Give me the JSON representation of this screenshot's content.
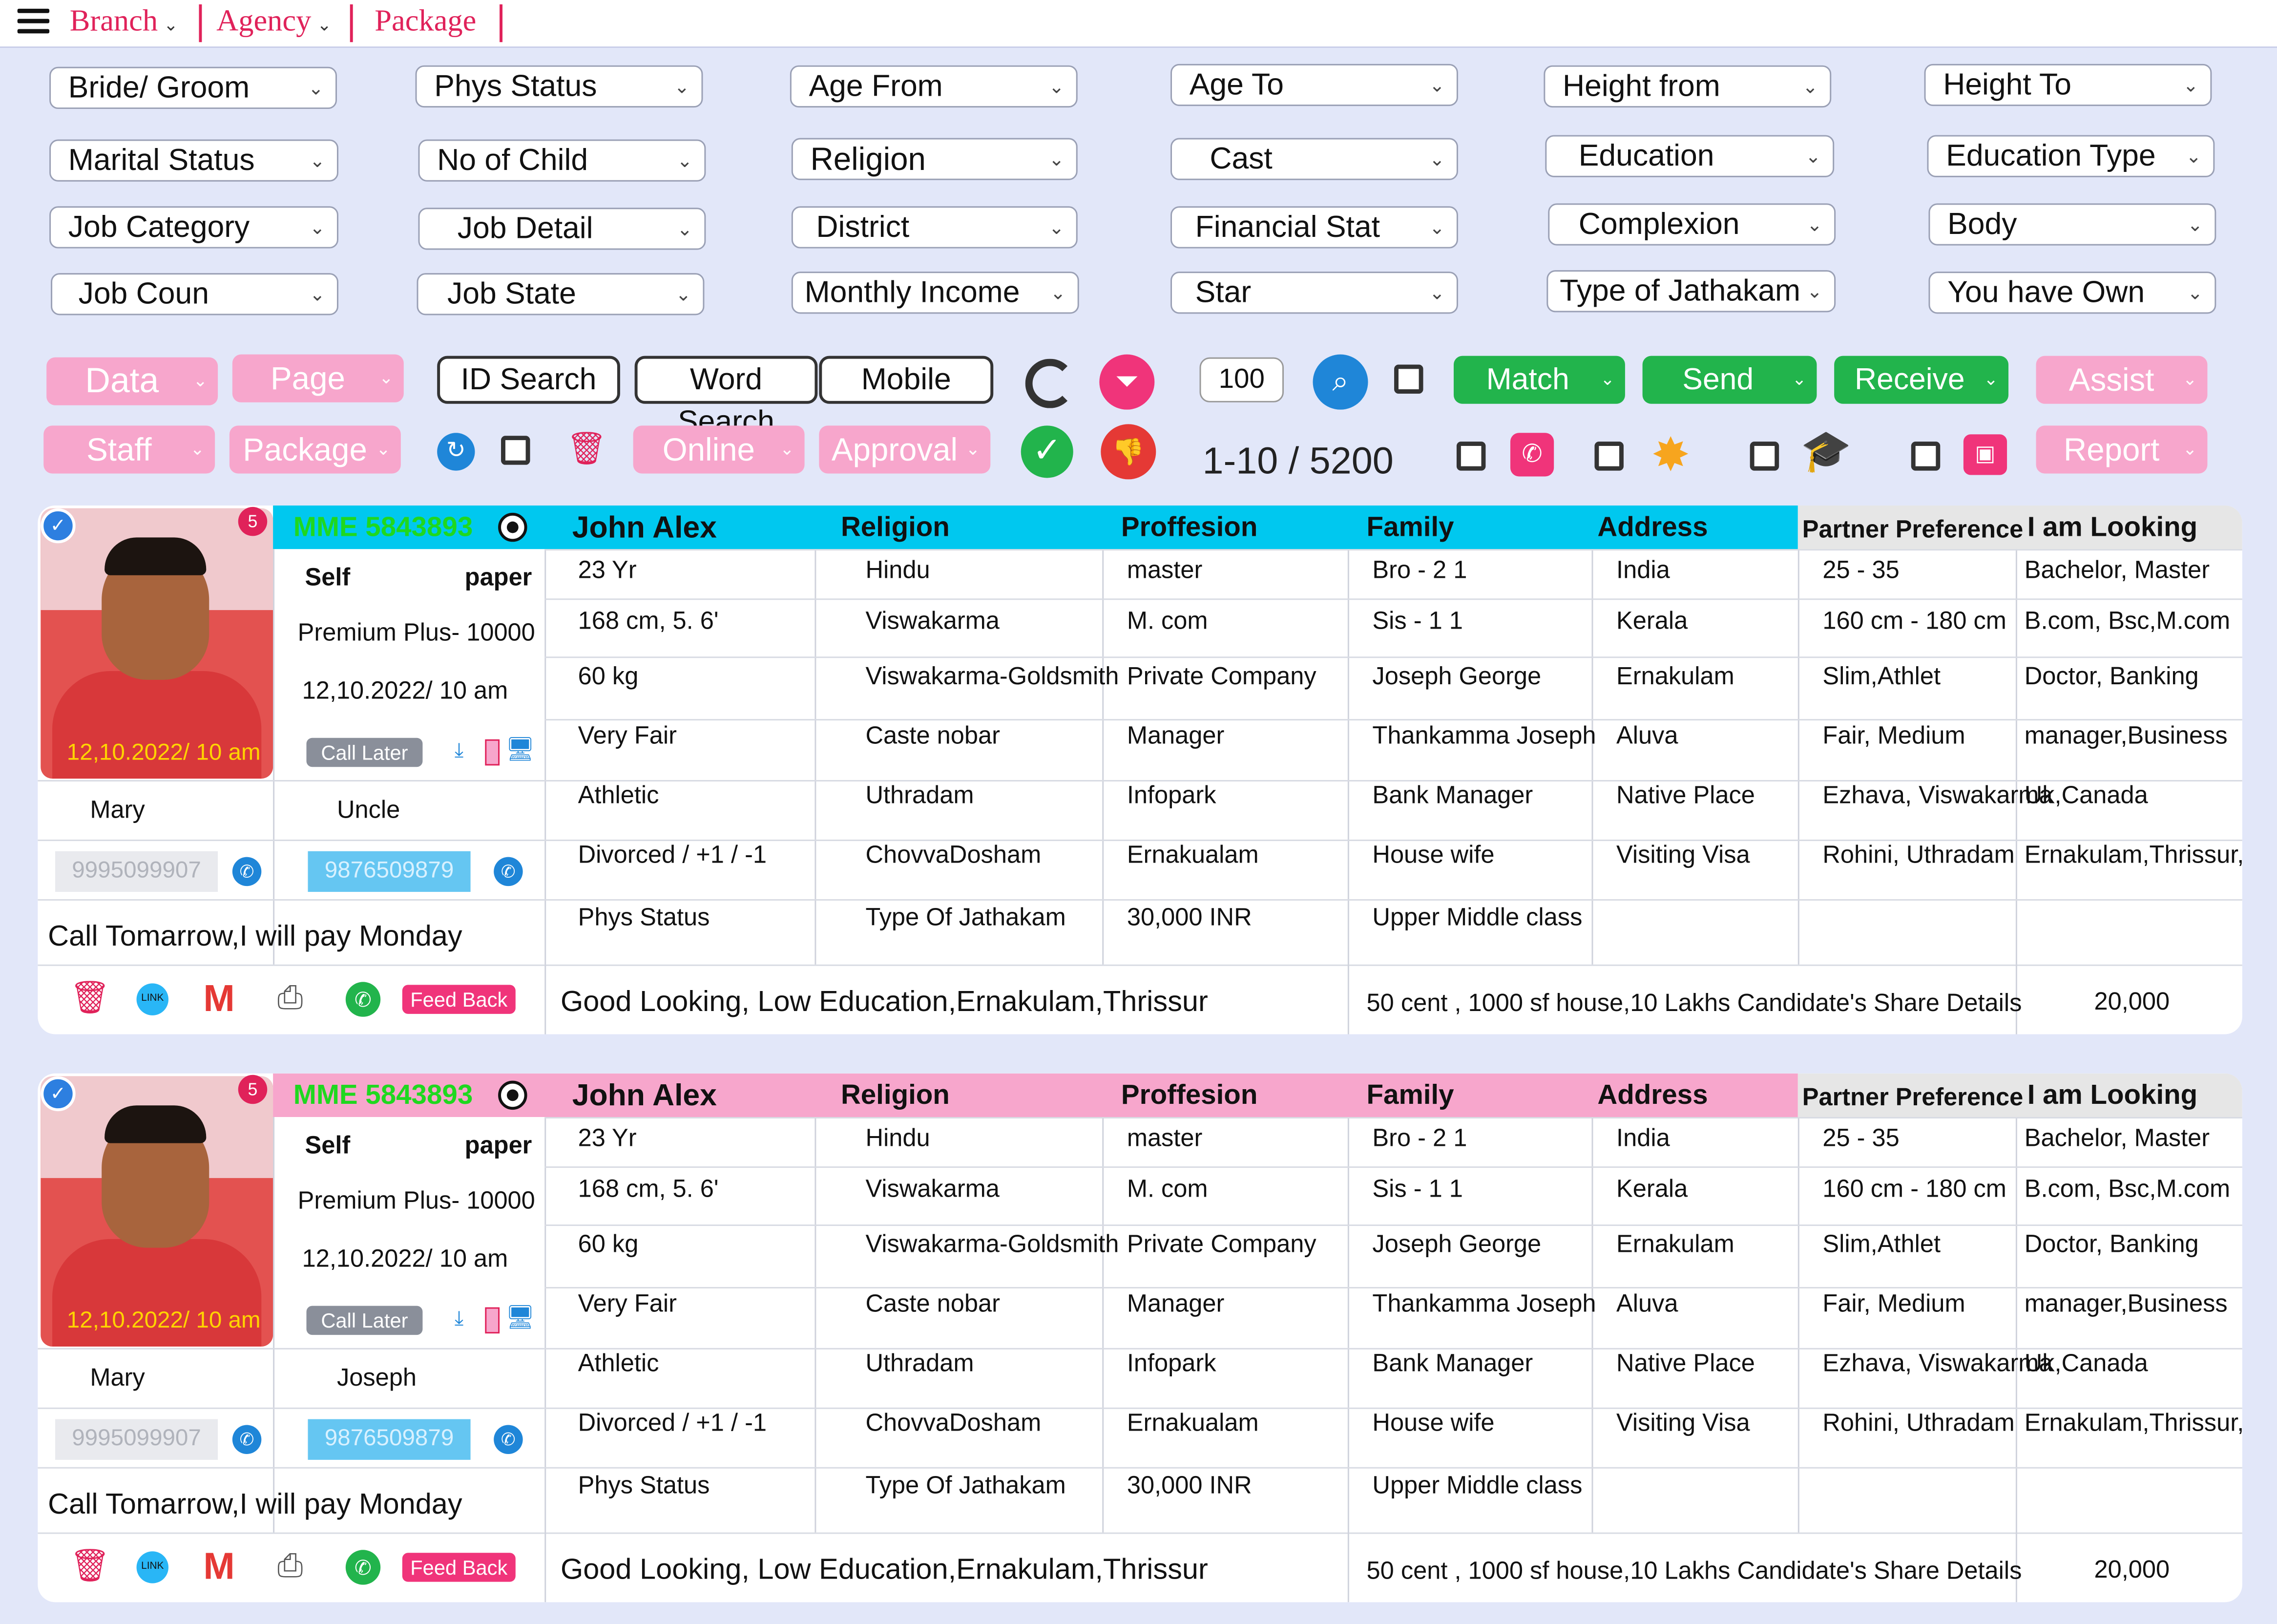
{
  "nav": [
    {
      "label": "Branch",
      "caret": "⌄"
    },
    {
      "label": "Agency",
      "caret": "⌄"
    },
    {
      "label": "Package",
      "caret": ""
    }
  ],
  "filters": [
    [
      "Bride/ Groom",
      "Phys Status",
      "Age From",
      "Age To",
      "Height from",
      "Height To"
    ],
    [
      "Marital Status",
      "No of Child",
      "Religion",
      "Cast",
      "Education",
      "Education Type"
    ],
    [
      "Job Category",
      "Job Detail",
      "District",
      "Financial Stat",
      "Complexion",
      "Body"
    ],
    [
      "Job Coun",
      "Job State",
      "Monthly Income",
      "Star",
      "Type of Jathakam",
      "You have Own"
    ]
  ],
  "toolbar": {
    "data": "Data",
    "page": "Page",
    "staff": "Staff",
    "package": "Package",
    "id_search": "ID Search",
    "word_search": "Word Search",
    "mobile": "Mobile",
    "per_page": "100",
    "online": "Online",
    "approval": "Approval",
    "range": "1-10 / 5200",
    "match": "Match",
    "send": "Send",
    "receive": "Receive",
    "assist": "Assist",
    "report": "Report"
  },
  "profiles": [
    {
      "id": "MME 5843893",
      "id_color": "#1fd81f",
      "badge": "5",
      "photo_date": "12,10.2022/ 10 am",
      "name": "John Alex",
      "header_color": "#00c8ef",
      "left": {
        "self": "Self",
        "paper": "paper",
        "plan": "Premium Plus- 10000",
        "datetime": "12,10.2022/ 10 am",
        "call_later": "Call Later",
        "contact1": "Mary",
        "contact2": "Uncle",
        "phone1": "9995099907",
        "phone2": "9876509879",
        "note": "Call Tomarrow,I will pay Monday",
        "feedback": "Feed Back"
      },
      "headers": [
        "Religion",
        "Proffesion",
        "Family",
        "Address",
        "Partner Preference",
        "I am Looking"
      ],
      "rows": [
        [
          "23 Yr",
          "Hindu",
          "master",
          "Bro -  2          1",
          "India",
          "25 - 35",
          "Bachelor, Master"
        ],
        [
          "168 cm, 5.  6'",
          "Viswakarma",
          "M. com",
          "Sis -   1           1",
          "Kerala",
          "160 cm - 180 cm",
          "B.com, Bsc,M.com"
        ],
        [
          "60 kg",
          "Viswakarma-Goldsmith",
          "Private Company",
          "Joseph George",
          "Ernakulam",
          "Slim,Athlet",
          "Doctor, Banking"
        ],
        [
          "Very Fair",
          "Caste nobar",
          "Manager",
          "Thankamma Joseph",
          "Aluva",
          "Fair, Medium",
          "manager,Business"
        ],
        [
          "Athletic",
          "Uthradam",
          "Infopark",
          "Bank Manager",
          "Native Place",
          "Ezhava, Viswakarma",
          "Uk,Canada"
        ],
        [
          "Divorced / +1 / -1",
          "ChovvaDosham",
          "Ernakualam",
          "House wife",
          "Visiting Visa",
          "Rohini, Uthradam",
          "Ernakulam,Thrissur,"
        ],
        [
          "Phys Status",
          "Type Of Jathakam",
          "30,000 INR",
          "Upper Middle class",
          "",
          "",
          ""
        ]
      ],
      "summary": "Good Looking, Low Education,Ernakulam,Thrissur",
      "share": "50 cent , 1000 sf house,10 Lakhs Candidate's Share Details",
      "amount": "20,000"
    },
    {
      "id": "MME 5843893",
      "id_color": "#1fd81f",
      "badge": "5",
      "photo_date": "12,10.2022/ 10 am",
      "name": "John Alex",
      "header_color": "#f7a6cc",
      "left": {
        "self": "Self",
        "paper": "paper",
        "plan": "Premium Plus- 10000",
        "datetime": "12,10.2022/ 10 am",
        "call_later": "Call Later",
        "contact1": "Mary",
        "contact2": "Joseph",
        "phone1": "9995099907",
        "phone2": "9876509879",
        "note": "Call Tomarrow,I will pay Monday",
        "feedback": "Feed Back"
      },
      "headers": [
        "Religion",
        "Proffesion",
        "Family",
        "Address",
        "Partner Preference",
        "I am Looking"
      ],
      "rows": [
        [
          "23 Yr",
          "Hindu",
          "master",
          "Bro -  2          1",
          "India",
          "25 - 35",
          "Bachelor, Master"
        ],
        [
          "168 cm, 5.  6'",
          "Viswakarma",
          "M. com",
          "Sis -   1           1",
          "Kerala",
          "160 cm - 180 cm",
          "B.com, Bsc,M.com"
        ],
        [
          "60 kg",
          "Viswakarma-Goldsmith",
          "Private Company",
          "Joseph George",
          "Ernakulam",
          "Slim,Athlet",
          "Doctor, Banking"
        ],
        [
          "Very Fair",
          "Caste nobar",
          "Manager",
          "Thankamma Joseph",
          "Aluva",
          "Fair, Medium",
          "manager,Business"
        ],
        [
          "Athletic",
          "Uthradam",
          "Infopark",
          "Bank Manager",
          "Native Place",
          "Ezhava, Viswakarma",
          "Uk,Canada"
        ],
        [
          "Divorced / +1 / -1",
          "ChovvaDosham",
          "Ernakualam",
          "House wife",
          "Visiting Visa",
          "Rohini, Uthradam",
          "Ernakulam,Thrissur,"
        ],
        [
          "Phys Status",
          "Type Of Jathakam",
          "30,000 INR",
          "Upper Middle class",
          "",
          "",
          ""
        ]
      ],
      "summary": "Good Looking, Low Education,Ernakulam,Thrissur",
      "share": "50 cent , 1000 sf house,10 Lakhs Candidate's Share Details",
      "amount": "20,000"
    }
  ],
  "colors": {
    "brand_pink": "#e0225a",
    "soft_pink": "#f7a6cc",
    "green": "#22b44c",
    "cyan": "#00c8ef",
    "background": "#e2e7f9"
  },
  "icons": [
    "menu-icon",
    "refresh-icon",
    "filter-icon",
    "search-icon",
    "sync-icon",
    "trash-icon",
    "check-icon",
    "thumbs-down-icon",
    "phone-icon",
    "star-icon",
    "graduation-cap-icon",
    "briefcase-icon",
    "link-icon",
    "gmail-icon",
    "printer-icon",
    "whatsapp-icon",
    "download-icon",
    "mobile-icon",
    "desktop-icon",
    "radio-icon",
    "verified-icon"
  ]
}
